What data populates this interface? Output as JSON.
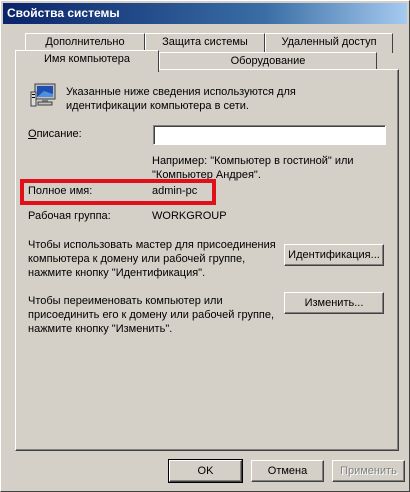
{
  "window": {
    "title": "Свойства системы"
  },
  "tabs_back": [
    {
      "label": "Дополнительно"
    },
    {
      "label": "Защита системы"
    },
    {
      "label": "Удаленный доступ"
    }
  ],
  "tabs_front": [
    {
      "label": "Имя компьютера",
      "active": true
    },
    {
      "label": "Оборудование",
      "active": false
    }
  ],
  "info": {
    "icon": "computer-icon",
    "text": "Указанные ниже сведения используются для идентификации компьютера в сети."
  },
  "description": {
    "label": "Описание:",
    "value": "",
    "example": "Например: \"Компьютер в гостиной\" или \"Компьютер Андрея\"."
  },
  "full_name": {
    "label": "Полное имя:",
    "value": "admin-pc"
  },
  "workgroup": {
    "label": "Рабочая группа:",
    "value": "WORKGROUP"
  },
  "identification": {
    "text": "Чтобы использовать мастер для присоединения компьютера к домену или рабочей группе, нажмите кнопку \"Идентификация\".",
    "button": "Идентификация..."
  },
  "rename": {
    "text": "Чтобы переименовать компьютер или присоединить его к домену или рабочей группе, нажмите кнопку \"Изменить\".",
    "button": "Изменить..."
  },
  "footer": {
    "ok": "OK",
    "cancel": "Отмена",
    "apply": "Применить"
  },
  "colors": {
    "highlight": "#e0101a",
    "title_start": "#0a246a",
    "title_end": "#a6caf0"
  }
}
